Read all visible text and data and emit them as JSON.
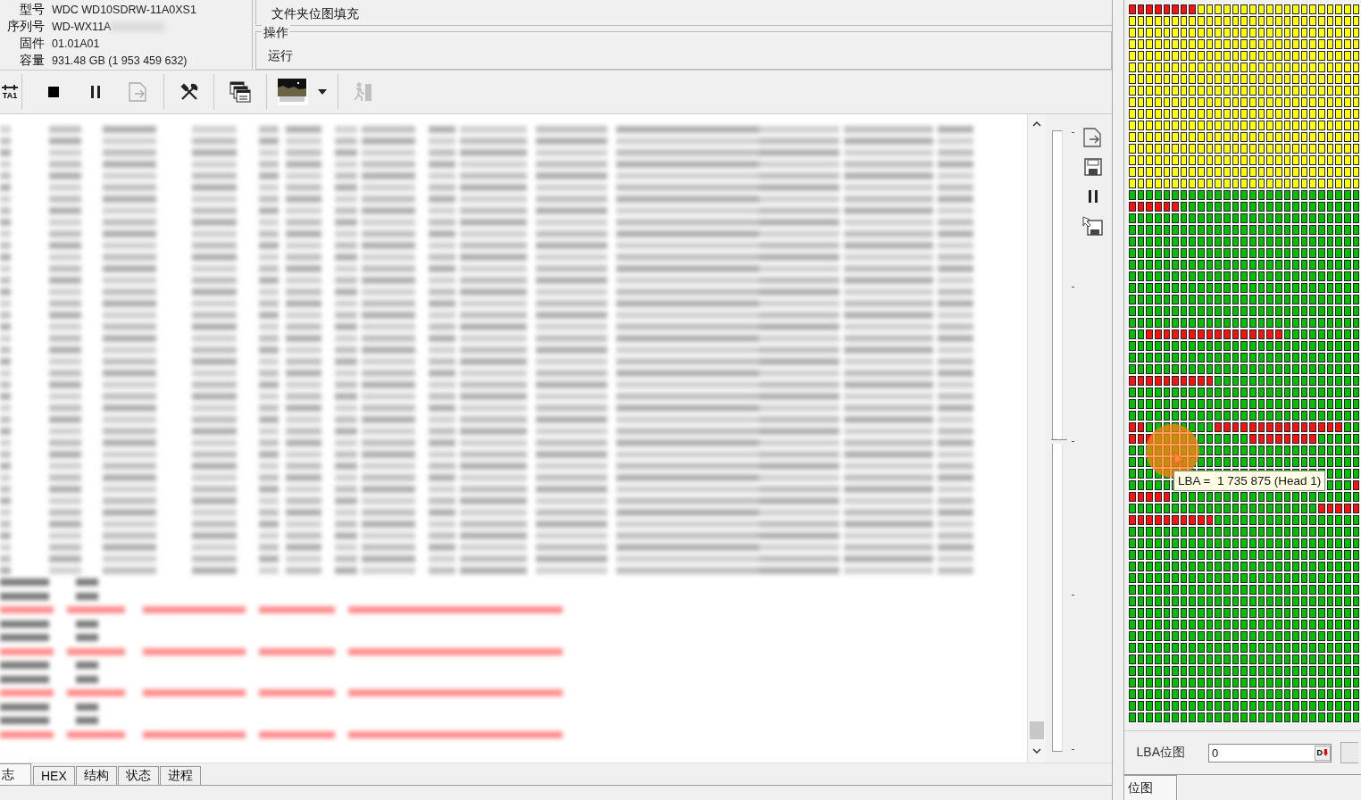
{
  "device_info": [
    {
      "label": "型号",
      "value": "WDC WD10SDRW-11A0XS1",
      "redacted": false
    },
    {
      "label": "序列号",
      "value": "WD-WX11A",
      "redacted": true
    },
    {
      "label": "固件",
      "value": "01.01A01",
      "redacted": false
    },
    {
      "label": "容量",
      "value": "931.48 GB (1 953 459 632)",
      "redacted": false
    }
  ],
  "mode": {
    "title": "文件夹位图填充"
  },
  "operation": {
    "legend": "操作",
    "value": "运行"
  },
  "toolbar": [
    {
      "kind": "port",
      "label": "TA1",
      "disabled": false
    },
    {
      "kind": "separator"
    },
    {
      "kind": "stop",
      "disabled": false
    },
    {
      "kind": "pause",
      "disabled": false
    },
    {
      "kind": "export",
      "disabled": true
    },
    {
      "kind": "separator"
    },
    {
      "kind": "tools",
      "disabled": false
    },
    {
      "kind": "separator"
    },
    {
      "kind": "windows",
      "disabled": false
    },
    {
      "kind": "separator"
    },
    {
      "kind": "thumbnail",
      "disabled": false
    },
    {
      "kind": "dropdown",
      "disabled": false
    },
    {
      "kind": "separator"
    },
    {
      "kind": "runner",
      "disabled": true
    }
  ],
  "side_tools": [
    {
      "kind": "export"
    },
    {
      "kind": "save"
    },
    {
      "kind": "pause"
    },
    {
      "kind": "save-as"
    }
  ],
  "slider": {
    "level": 0.5
  },
  "bottom_tabs": [
    {
      "label": "志",
      "selected": true
    },
    {
      "label": "HEX",
      "selected": false
    },
    {
      "label": "结构",
      "selected": false
    },
    {
      "label": "状态",
      "selected": false
    },
    {
      "label": "进程",
      "selected": false
    }
  ],
  "bitmap": {
    "tooltip": "LBA =  1 735 875 (Head 1)"
  },
  "lba_field": {
    "label": "LBA位图",
    "value": "0",
    "button": "D"
  },
  "right_tabs": [
    {
      "label": "位图",
      "selected": true
    }
  ]
}
